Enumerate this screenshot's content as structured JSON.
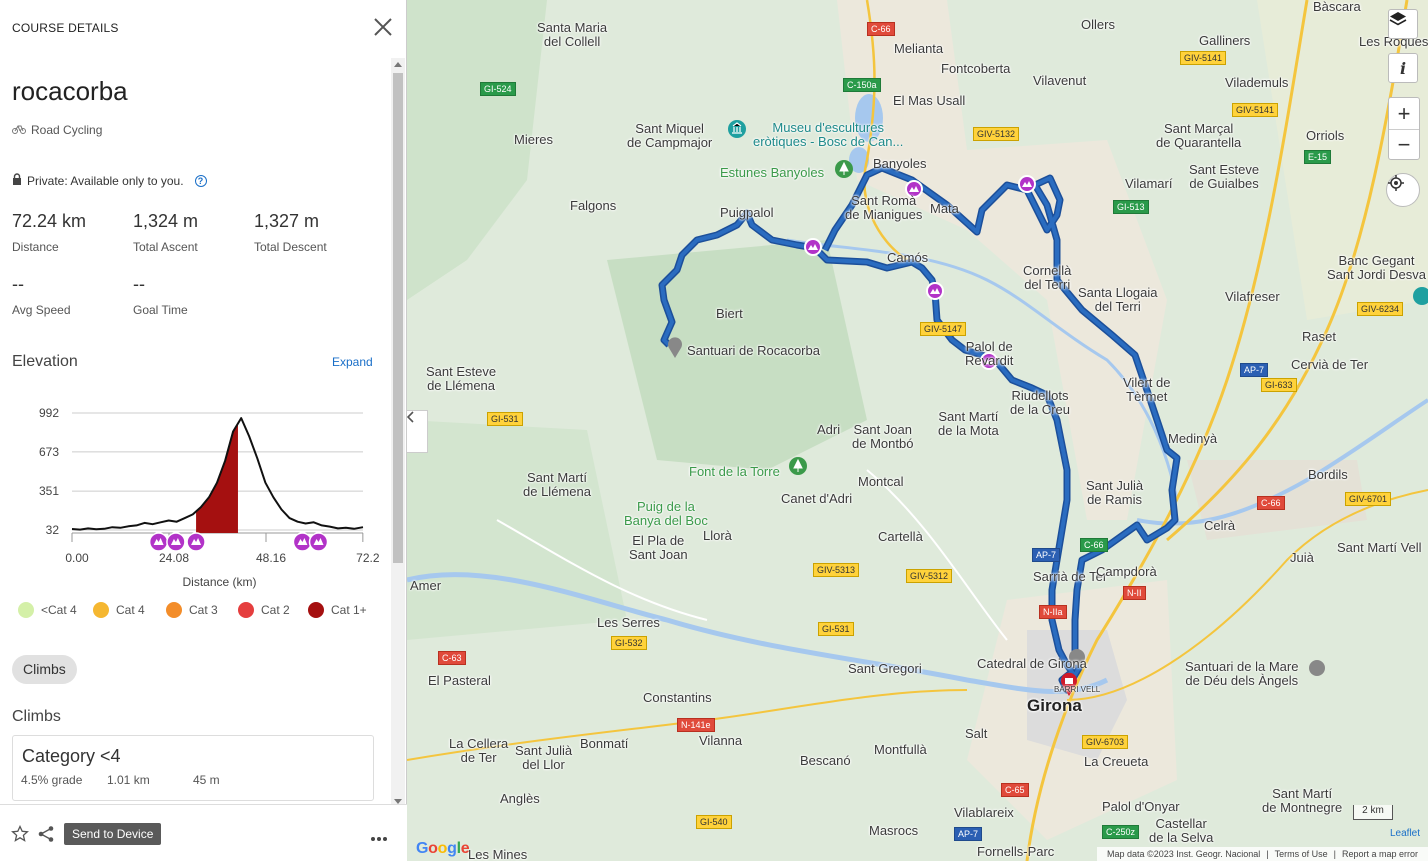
{
  "panel": {
    "header_title": "COURSE DETAILS",
    "course_name": "rocacorba",
    "activity_type": "Road Cycling",
    "privacy_text": "Private: Available only to you.",
    "stats": [
      {
        "value": "72.24 km",
        "label": "Distance"
      },
      {
        "value": "1,324 m",
        "label": "Total Ascent"
      },
      {
        "value": "1,327 m",
        "label": "Total Descent"
      },
      {
        "value": "--",
        "label": "Avg Speed"
      },
      {
        "value": "--",
        "label": "Goal Time"
      }
    ],
    "elevation_title": "Elevation",
    "expand_label": "Expand",
    "climbs_pill": "Climbs",
    "climbs_title": "Climbs",
    "climb_card": {
      "category": "Category <4",
      "grade": "4.5% grade",
      "distance": "1.01 km",
      "gain": "45 m"
    },
    "footer": {
      "send_label": "Send to Device"
    }
  },
  "chart_data": {
    "type": "area",
    "xlabel": "Distance (km)",
    "x_ticks": [
      "0.00",
      "24.08",
      "48.16",
      "72.2"
    ],
    "y_ticks": [
      "992",
      "673",
      "351",
      "32"
    ],
    "xlim": [
      0,
      72.24
    ],
    "ylim": [
      32,
      992
    ],
    "series": [
      {
        "x": [
          0,
          2,
          4,
          6,
          8,
          10,
          12,
          14,
          16,
          18,
          20,
          22,
          24,
          26,
          28,
          30,
          32,
          34,
          36,
          38,
          40,
          42,
          44,
          46,
          48,
          50,
          52,
          54,
          56,
          58,
          60,
          62,
          64,
          66,
          68,
          70,
          72.24
        ],
        "y": [
          40,
          35,
          45,
          38,
          42,
          55,
          50,
          62,
          70,
          90,
          80,
          95,
          110,
          100,
          130,
          160,
          220,
          300,
          420,
          600,
          840,
          950,
          800,
          620,
          420,
          300,
          200,
          130,
          100,
          85,
          95,
          70,
          60,
          45,
          50,
          42,
          55
        ]
      }
    ],
    "climb_segments": [
      {
        "category": "Cat 1+",
        "start_km": 30.8,
        "end_km": 41.2
      }
    ],
    "legend": [
      {
        "label": "<Cat 4",
        "color": "#d4f0a8"
      },
      {
        "label": "Cat 4",
        "color": "#f5b731"
      },
      {
        "label": "Cat 3",
        "color": "#f38d2a"
      },
      {
        "label": "Cat 2",
        "color": "#e53e3e"
      },
      {
        "label": "Cat 1+",
        "color": "#a51010"
      }
    ],
    "markers_km": [
      21.5,
      25.8,
      30.8,
      57.2,
      61.2
    ]
  },
  "map": {
    "places": [
      {
        "name": "Santa Maria\ndel Collell"
      },
      {
        "name": "Melianta"
      },
      {
        "name": "Ollers"
      },
      {
        "name": "Bàscara"
      },
      {
        "name": "Fontcoberta"
      },
      {
        "name": "Galliners"
      },
      {
        "name": "Les Roques"
      },
      {
        "name": "Vilavenut"
      },
      {
        "name": "Vilademuls"
      },
      {
        "name": "El Mas Usall"
      },
      {
        "name": "Mieres"
      },
      {
        "name": "Sant Miquel\nde Campmajor"
      },
      {
        "name": "Museu d'escultures\neròtiques - Bosc de Can..."
      },
      {
        "name": "Banyoles"
      },
      {
        "name": "Sant Marçal\nde Quarantella"
      },
      {
        "name": "Orriols"
      },
      {
        "name": "Estunes Banyoles"
      },
      {
        "name": "Vilamarí"
      },
      {
        "name": "Sant Esteve\nde Guialbes"
      },
      {
        "name": "Falgons"
      },
      {
        "name": "Sant Romà\nde Mianigues"
      },
      {
        "name": "Mata"
      },
      {
        "name": "Puigpalol"
      },
      {
        "name": "Camós"
      },
      {
        "name": "Cornellà\ndel Terri"
      },
      {
        "name": "Banc Gegant\nSant Jordi Desva"
      },
      {
        "name": "Santa Llogaia\ndel Terri"
      },
      {
        "name": "Vilafreser"
      },
      {
        "name": "Biert"
      },
      {
        "name": "Santuari de Rocacorba"
      },
      {
        "name": "Palol de\nRevardit"
      },
      {
        "name": "Raset"
      },
      {
        "name": "Cervià de Ter"
      },
      {
        "name": "Sant Esteve\nde Llémena"
      },
      {
        "name": "Vilert de\nTèrmet"
      },
      {
        "name": "Riudellots\nde la Creu"
      },
      {
        "name": "Sant Martí\nde la Mota"
      },
      {
        "name": "Adri"
      },
      {
        "name": "Sant Joan\nde Montbó"
      },
      {
        "name": "Medinyà"
      },
      {
        "name": "Font de la Torre"
      },
      {
        "name": "Canet d'Adri"
      },
      {
        "name": "Montcal"
      },
      {
        "name": "Sant Martí\nde Llémena"
      },
      {
        "name": "Bordils"
      },
      {
        "name": "Sant Julià\nde Ramis"
      },
      {
        "name": "Puig de la\nBanya del Boc"
      },
      {
        "name": "El Pla de\nSant Joan"
      },
      {
        "name": "Llorà"
      },
      {
        "name": "Cartellà"
      },
      {
        "name": "Celrà"
      },
      {
        "name": "Sant Martí Vell"
      },
      {
        "name": "Juià"
      },
      {
        "name": "Amer"
      },
      {
        "name": "Sarrià de Ter"
      },
      {
        "name": "Campdorà"
      },
      {
        "name": "Les Serres"
      },
      {
        "name": "Sant Gregori"
      },
      {
        "name": "Catedral de Girona"
      },
      {
        "name": "Santuari de la Mare\nde Déu dels Àngels"
      },
      {
        "name": "El Pasteral"
      },
      {
        "name": "Constantins"
      },
      {
        "name": "BARRI VELL"
      },
      {
        "name": "Girona"
      },
      {
        "name": "La Cellera\nde Ter"
      },
      {
        "name": "Sant Julià\ndel Llor"
      },
      {
        "name": "Bonmatí"
      },
      {
        "name": "Vilanna"
      },
      {
        "name": "Montfullà"
      },
      {
        "name": "Salt"
      },
      {
        "name": "Bescanó"
      },
      {
        "name": "La Creueta"
      },
      {
        "name": "Anglès"
      },
      {
        "name": "Palol d'Onyar"
      },
      {
        "name": "Sant Martí\nde Montnegre"
      },
      {
        "name": "Vilablareix"
      },
      {
        "name": "Masrocs"
      },
      {
        "name": "Castellar\nde la Selva"
      },
      {
        "name": "Les Mines"
      },
      {
        "name": "Fornells-Parc"
      }
    ],
    "roads": [
      "C-66",
      "C-150a",
      "GI-524",
      "GIV-5132",
      "GIV-5141",
      "GIV-5141",
      "E-15",
      "GI-513",
      "GIV-6234",
      "GIV-5147",
      "GI-633",
      "AP-7",
      "GI-531",
      "C-66",
      "GIV-6701",
      "GIV-5313",
      "GIV-5312",
      "AP-7",
      "C-66",
      "GI-531",
      "GI-532",
      "N-II",
      "N-IIa",
      "C-63",
      "N-141e",
      "GIV-6703",
      "C-65",
      "GI-540",
      "AP-7",
      "C-250z"
    ],
    "scale_label": "2 km",
    "leaflet_label": "Leaflet",
    "attribution": [
      "Map data ©2023 Inst. Geogr. Nacional",
      "Terms of Use",
      "Report a map error"
    ],
    "google_label": "Google",
    "info_label": "i",
    "zoom_in_label": "+",
    "zoom_out_label": "−",
    "route_color": "#2a6cc0",
    "finish_marker_color": "#d0192a",
    "climb_marker_color": "#b233c8"
  }
}
